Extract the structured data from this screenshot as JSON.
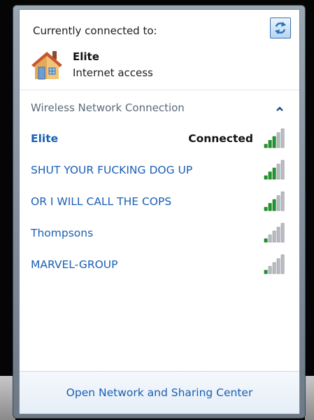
{
  "header": {
    "currently_connected_label": "Currently connected to:",
    "connected_network": {
      "name": "Elite",
      "status": "Internet access"
    }
  },
  "section": {
    "title": "Wireless Network Connection",
    "collapse_icon": "chevron-up-icon"
  },
  "networks": [
    {
      "name": "Elite",
      "status": "Connected",
      "signal_bars": 3,
      "selected": true
    },
    {
      "name": "SHUT YOUR FUCKING DOG UP",
      "status": "",
      "signal_bars": 3,
      "selected": false
    },
    {
      "name": "OR I WILL CALL THE COPS",
      "status": "",
      "signal_bars": 3,
      "selected": false
    },
    {
      "name": "Thompsons",
      "status": "",
      "signal_bars": 1,
      "selected": false
    },
    {
      "name": "MARVEL-GROUP",
      "status": "",
      "signal_bars": 1,
      "selected": false
    }
  ],
  "footer": {
    "link_label": "Open Network and Sharing Center"
  },
  "icons": {
    "refresh": "refresh-icon",
    "network": "house-icon",
    "signal": "signal-strength-icon"
  },
  "colors": {
    "link_blue": "#1a5fb4",
    "signal_green": "#1f9a2a",
    "signal_gray": "#b8bcc2"
  }
}
